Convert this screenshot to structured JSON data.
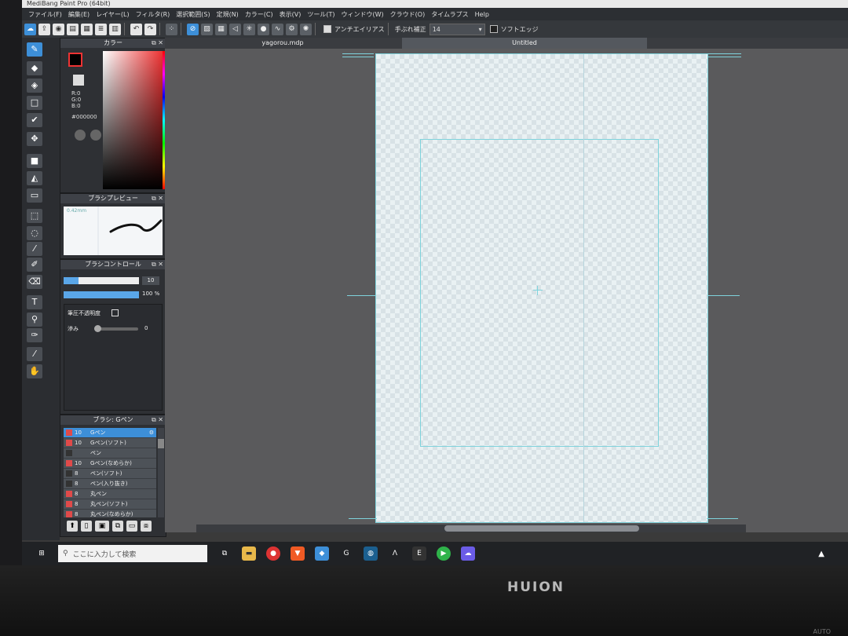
{
  "app": {
    "title": "MediBang Paint Pro (64bit)"
  },
  "menu": [
    "ファイル(F)",
    "編集(E)",
    "レイヤー(L)",
    "フィルタ(R)",
    "選択範囲(S)",
    "定規(N)",
    "カラー(C)",
    "表示(V)",
    "ツール(T)",
    "ウィンドウ(W)",
    "クラウド(O)",
    "タイムラプス",
    "Help"
  ],
  "toolbar": {
    "antialias_label": "アンチエイリアス",
    "stabilizer_label": "手ぶれ補正",
    "stabilizer_value": "14",
    "softedge_label": "ソフトエッジ"
  },
  "color_panel": {
    "title": "カラー",
    "r": "R:0",
    "g": "G:0",
    "b": "B:0",
    "hex": "#000000",
    "accent": "#3d8fd8"
  },
  "brush_preview": {
    "title": "ブラシプレビュー",
    "size_label": "0.42mm"
  },
  "brush_control": {
    "title": "ブラシコントロール",
    "size_value": "10",
    "opacity_value": "100 %",
    "pressure_label": "筆圧不透明度",
    "blur_label": "滲み",
    "blur_value": "0"
  },
  "brush_list": {
    "title": "ブラシ: Gペン",
    "items": [
      {
        "size": "10",
        "name": "Gペン",
        "color": "#e04a4a"
      },
      {
        "size": "10",
        "name": "Gペン(ソフト)",
        "color": "#e04a4a"
      },
      {
        "size": "",
        "name": "ペン",
        "color": "#333333"
      },
      {
        "size": "10",
        "name": "Gペン(なめらか)",
        "color": "#e04a4a"
      },
      {
        "size": "8",
        "name": "ペン(ソフト)",
        "color": "#333333"
      },
      {
        "size": "8",
        "name": "ペン(入り抜き)",
        "color": "#333333"
      },
      {
        "size": "8",
        "name": "丸ペン",
        "color": "#e04a4a"
      },
      {
        "size": "8",
        "name": "丸ペン(ソフト)",
        "color": "#e04a4a"
      },
      {
        "size": "8",
        "name": "丸ペン(なめらか)",
        "color": "#e04a4a"
      }
    ]
  },
  "tabs": [
    "yagorou.mdp",
    "Untitled"
  ],
  "taskbar": {
    "search_placeholder": "ここに入力して検索"
  },
  "monitor": {
    "brand": "HUION",
    "label": "AUTO"
  }
}
